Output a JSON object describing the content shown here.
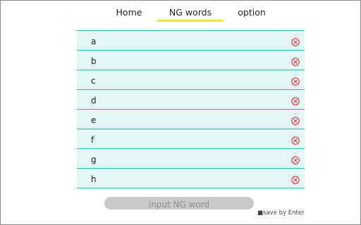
{
  "colors": {
    "accent_underline": "#f0e24a",
    "row_background": "#e3f5f4",
    "row_border": "#2bb5a6",
    "delete_icon": "#e0303a",
    "input_background": "#c9c9c9"
  },
  "tabs": [
    {
      "label": "Home",
      "active": false
    },
    {
      "label": "NG words",
      "active": true
    },
    {
      "label": "option",
      "active": false
    }
  ],
  "ng_words": [
    {
      "word": "a",
      "delete_icon": "circle-x-icon"
    },
    {
      "word": "b",
      "delete_icon": "circle-x-icon"
    },
    {
      "word": "c",
      "delete_icon": "circle-x-icon"
    },
    {
      "word": "d",
      "delete_icon": "circle-x-icon"
    },
    {
      "word": "e",
      "delete_icon": "circle-x-icon"
    },
    {
      "word": "f",
      "delete_icon": "circle-x-icon"
    },
    {
      "word": "g",
      "delete_icon": "circle-x-icon"
    },
    {
      "word": "h",
      "delete_icon": "circle-x-icon"
    }
  ],
  "input": {
    "value": "",
    "placeholder": "input NG word"
  },
  "hint": "■save by Enter"
}
